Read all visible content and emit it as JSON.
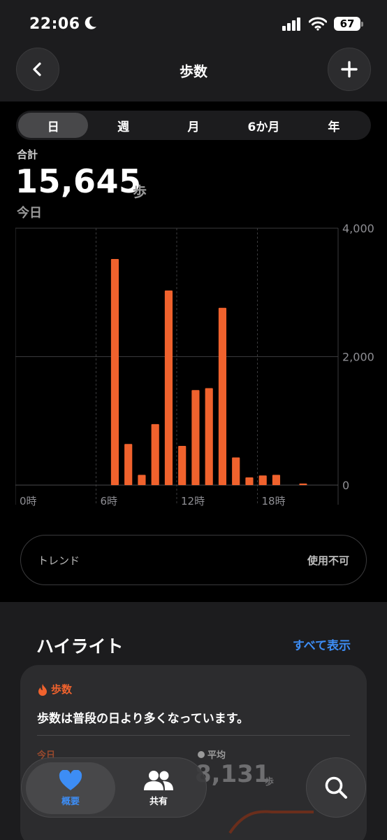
{
  "status": {
    "time": "22:06",
    "battery": "67"
  },
  "nav": {
    "title": "歩数"
  },
  "segments": [
    "日",
    "週",
    "月",
    "6か月",
    "年"
  ],
  "summary": {
    "label": "合計",
    "value": "15,645",
    "unit": "歩",
    "period": "今日"
  },
  "chart_data": {
    "type": "bar",
    "x_unit": "hour",
    "x_ticks": [
      "0時",
      "6時",
      "12時",
      "18時"
    ],
    "y_ticks": [
      "4,000",
      "2,000",
      "0"
    ],
    "ylim": [
      0,
      4000
    ],
    "color": "#f0622d",
    "bars": [
      {
        "hour": 7,
        "value": 3520
      },
      {
        "hour": 8,
        "value": 640
      },
      {
        "hour": 9,
        "value": 160
      },
      {
        "hour": 10,
        "value": 950
      },
      {
        "hour": 11,
        "value": 3030
      },
      {
        "hour": 12,
        "value": 610
      },
      {
        "hour": 13,
        "value": 1480
      },
      {
        "hour": 14,
        "value": 1510
      },
      {
        "hour": 15,
        "value": 2760
      },
      {
        "hour": 16,
        "value": 430
      },
      {
        "hour": 17,
        "value": 120
      },
      {
        "hour": 18,
        "value": 150
      },
      {
        "hour": 19,
        "value": 160
      },
      {
        "hour": 21,
        "value": 25
      }
    ]
  },
  "trend": {
    "label": "トレンド",
    "value": "使用不可"
  },
  "highlights": {
    "title": "ハイライト",
    "show_all": "すべて表示",
    "card": {
      "category": "歩数",
      "message": "歩数は普段の日より多くなっています。",
      "today_label": "今日",
      "average_label": "平均",
      "average_value": "8,131",
      "average_unit": "歩"
    }
  },
  "tabbar": {
    "summary": "概要",
    "sharing": "共有"
  },
  "colors": {
    "accent": "#f0622d",
    "link": "#3d8df5"
  }
}
